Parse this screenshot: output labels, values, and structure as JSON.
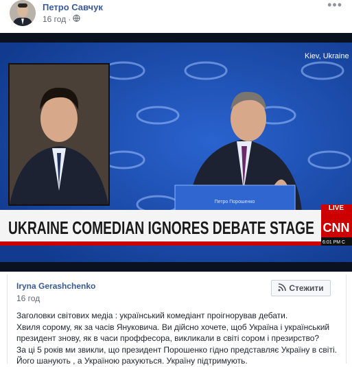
{
  "post": {
    "author": "Петро Савчук",
    "time": "16 год",
    "more_label": "•••",
    "icons": {
      "privacy": "globe-icon",
      "more": "more-dots-icon"
    }
  },
  "image": {
    "headline": "UKRAINE COMEDIAN IGNORES DEBATE STAGE",
    "location": "Kiev, Ukraine",
    "cnn_logo": "CNN",
    "live": "LIVE",
    "clock": "6:01 PM C",
    "podium_name": "Петро Порошенко"
  },
  "shared": {
    "author": "Iryna Gerashchenko",
    "time": "16 год",
    "follow_label": "Стежити",
    "follow_icon": "rss-icon",
    "text_lines": [
      "Заголовки світових медіа : український комедіант проігнорував дебати.",
      "Хвиля сорому, як за часів Януковича. Ви дійсно хочете, щоб Україна і український",
      "президент знову, як в часи проффесора, викликали в світі сором і презирство?",
      "За ці 5 років ми звикли, що президент Порошенко гідно представляє Україну в світі.",
      "Його шанують , а Україною рахуються. Україну підтримують."
    ]
  },
  "colors": {
    "link": "#385898",
    "cnn_red": "#cc0000",
    "stage_blue": "#1d4fb8"
  }
}
